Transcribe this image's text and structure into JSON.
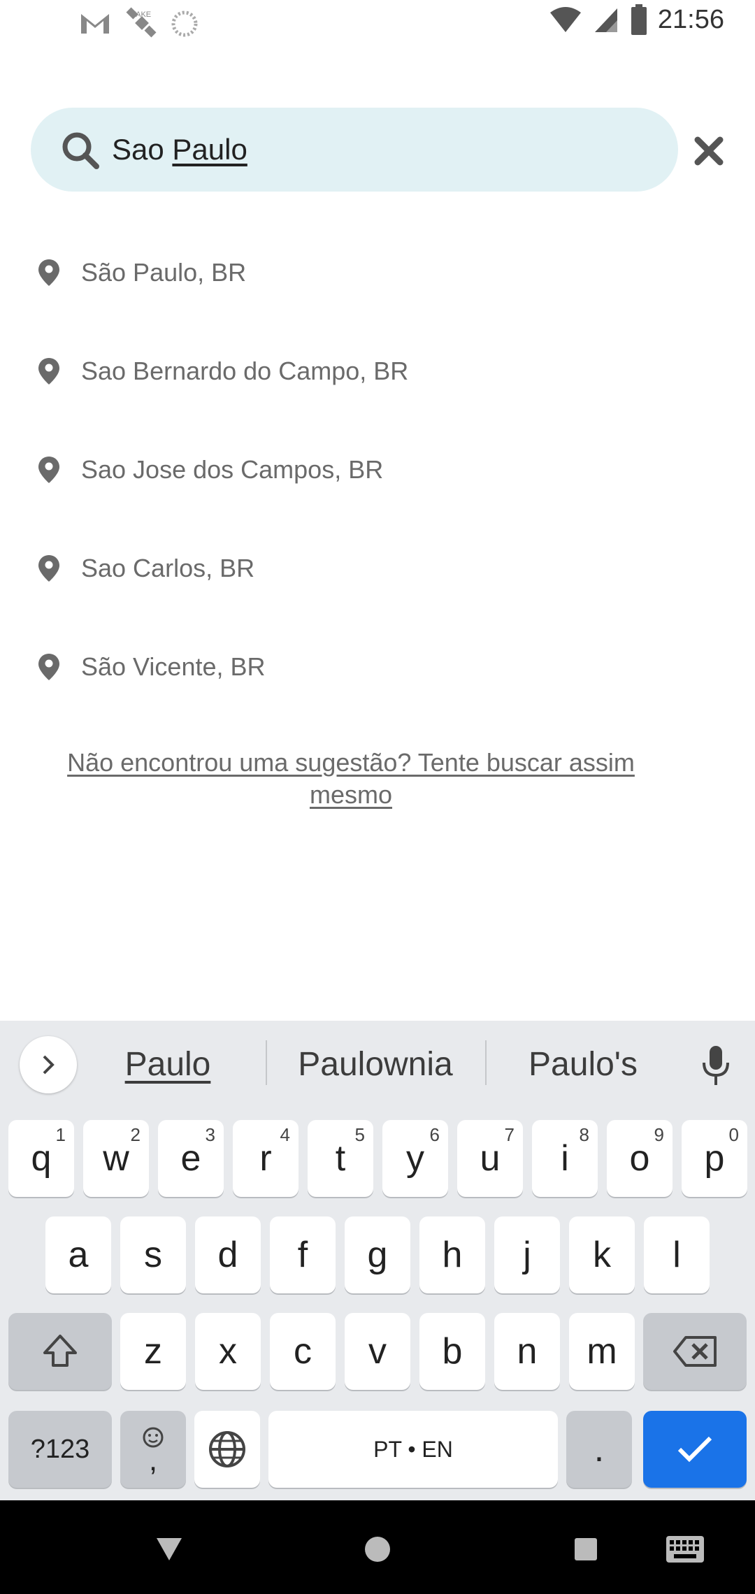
{
  "status_bar": {
    "time": "21:56",
    "left_icons": [
      "gmail-icon",
      "satellite-icon",
      "sync-icon"
    ],
    "right_icons": [
      "wifi-icon",
      "signal-icon",
      "battery-icon"
    ]
  },
  "search": {
    "value_prefix": "Sao ",
    "value_underlined": "Paulo",
    "icon": "search-icon",
    "clear_icon": "close-icon"
  },
  "suggestions": [
    {
      "label": "São Paulo, BR",
      "icon": "pin-icon"
    },
    {
      "label": "Sao Bernardo do Campo, BR",
      "icon": "pin-icon"
    },
    {
      "label": "Sao Jose dos Campos, BR",
      "icon": "pin-icon"
    },
    {
      "label": "Sao Carlos, BR",
      "icon": "pin-icon"
    },
    {
      "label": "São Vicente, BR",
      "icon": "pin-icon"
    }
  ],
  "search_anyway_link": "Não encontrou uma sugestão? Tente buscar assim mesmo",
  "keyboard": {
    "word_suggestions": [
      "Paulo",
      "Paulownia",
      "Paulo's"
    ],
    "row1": [
      {
        "k": "q",
        "h": "1"
      },
      {
        "k": "w",
        "h": "2"
      },
      {
        "k": "e",
        "h": "3"
      },
      {
        "k": "r",
        "h": "4"
      },
      {
        "k": "t",
        "h": "5"
      },
      {
        "k": "y",
        "h": "6"
      },
      {
        "k": "u",
        "h": "7"
      },
      {
        "k": "i",
        "h": "8"
      },
      {
        "k": "o",
        "h": "9"
      },
      {
        "k": "p",
        "h": "0"
      }
    ],
    "row2": [
      "a",
      "s",
      "d",
      "f",
      "g",
      "h",
      "j",
      "k",
      "l"
    ],
    "row3": [
      "z",
      "x",
      "c",
      "v",
      "b",
      "n",
      "m"
    ],
    "symbols_label": "?123",
    "emoji_comma": ",",
    "space_label": "PT • EN",
    "period": ".",
    "colors": {
      "action": "#1a73e8",
      "background": "#e8eaed",
      "function_key": "#c6c9ce"
    }
  },
  "colors": {
    "search_pill": "#e1f1f4",
    "text_secondary": "#6a6a6a"
  }
}
